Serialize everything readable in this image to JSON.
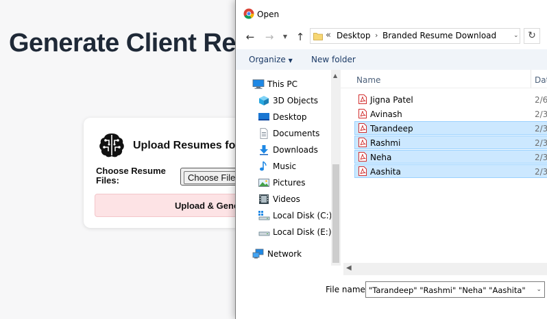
{
  "page": {
    "title": "Generate Client Re",
    "card": {
      "title": "Upload Resumes fo",
      "choose_label": "Choose Resume Files:",
      "file_button": "Choose File",
      "generate_button": "Upload & Gene",
      "icon": "brain-icon"
    }
  },
  "dialog": {
    "title": "Open",
    "app_icon": "chrome-icon",
    "address": {
      "prefix": "«",
      "crumbs": [
        "Desktop",
        "Branded Resume Download"
      ]
    },
    "toolbar": {
      "organize": "Organize",
      "new_folder": "New folder"
    },
    "nav": [
      {
        "label": "This PC",
        "icon": "computer-icon"
      },
      {
        "label": "3D Objects",
        "icon": "cube-icon"
      },
      {
        "label": "Desktop",
        "icon": "desktop-icon"
      },
      {
        "label": "Documents",
        "icon": "document-icon"
      },
      {
        "label": "Downloads",
        "icon": "download-icon"
      },
      {
        "label": "Music",
        "icon": "music-icon"
      },
      {
        "label": "Pictures",
        "icon": "picture-icon"
      },
      {
        "label": "Videos",
        "icon": "video-icon"
      },
      {
        "label": "Local Disk (C:)",
        "icon": "drive-icon"
      },
      {
        "label": "Local Disk (E:)",
        "icon": "drive-icon"
      },
      {
        "label": "Network",
        "icon": "network-icon"
      }
    ],
    "columns": {
      "name": "Name",
      "date": "Dat"
    },
    "files": [
      {
        "name": "Jigna Patel",
        "date": "2/6,",
        "selected": false
      },
      {
        "name": "Avinash",
        "date": "2/3,",
        "selected": false
      },
      {
        "name": "Tarandeep",
        "date": "2/3,",
        "selected": true
      },
      {
        "name": "Rashmi",
        "date": "2/3,",
        "selected": true
      },
      {
        "name": "Neha",
        "date": "2/3,",
        "selected": true
      },
      {
        "name": "Aashita",
        "date": "2/3,",
        "selected": true
      }
    ],
    "file_name_label": "File name:",
    "file_name_value": "\"Tarandeep\" \"Rashmi\" \"Neha\" \"Aashita\"",
    "colors": {
      "selection_bg": "#cce8ff",
      "selection_border": "#99d1ff",
      "command_bar": "#f0f4f9",
      "pdf_red": "#d12d2d"
    }
  }
}
